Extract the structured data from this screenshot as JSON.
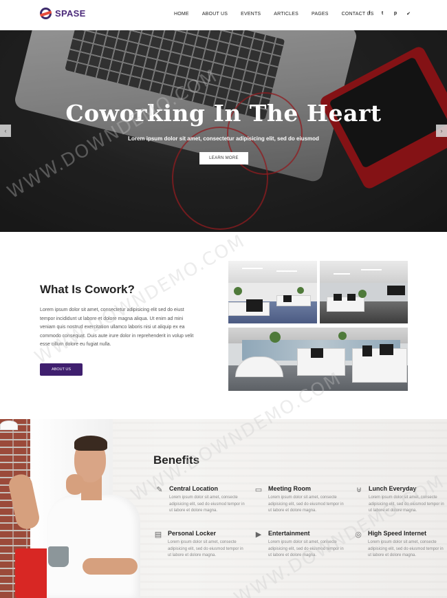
{
  "header": {
    "logo_text": "SPASE",
    "nav": [
      "HOME",
      "ABOUT US",
      "EVENTS",
      "ARTICLES",
      "PAGES",
      "CONTACT US"
    ],
    "social": [
      {
        "glyph": "f",
        "icon": "facebook-icon"
      },
      {
        "glyph": "t",
        "icon": "tumblr-icon"
      },
      {
        "glyph": "p",
        "icon": "pinterest-icon"
      },
      {
        "glyph": "✔",
        "icon": "twitter-icon"
      }
    ]
  },
  "hero": {
    "title": "Coworking In The Heart",
    "subtitle": "Lorem ipsum dolor sit amet, consectetur adipisicing elit, sed do eiusmod",
    "button": "LEARN MORE",
    "prev_arrow": "‹",
    "next_arrow": "›"
  },
  "about": {
    "title": "What Is Cowork?",
    "text": "Lorem ipsum dolor sit amet, consectetur adipisicing elit sed do eiust tempor incididunt ut labore et dolore magna aliqua. Ut enim ad mini veniam quis nostrud exercitation ullamco laboris nisi ut aliquip ex ea commodo consequat. Duis aute irure dolor in reprehenderit in volup velit esse cillum dolore eu fugiat nulla.",
    "button": "ABOUT US"
  },
  "benefits": {
    "title": "Benefits",
    "items": [
      {
        "title": "Central Location",
        "icon": "pencil-icon",
        "glyph": "✎",
        "text": "Lorem ipsum dolor sit amet, consecte adipisicing elit, sed do eiusmod tempor in ut labore et dolore magna."
      },
      {
        "title": "Meeting Room",
        "icon": "presentation-icon",
        "glyph": "▭",
        "text": "Lorem ipsum dolor sit amet, consecte adipisicing elit, sed do eiusmod tempor in ut labore et dolore magna."
      },
      {
        "title": "Lunch Everyday",
        "icon": "basket-icon",
        "glyph": "⊎",
        "text": "Lorem ipsum dolor sit amet, consecte adipisicing elit, sed do eiusmod tempor in ut labore et dolore magna."
      },
      {
        "title": "Personal Locker",
        "icon": "locker-icon",
        "glyph": "▤",
        "text": "Lorem ipsum dolor sit amet, consecte adipisicing elit, sed do eiusmod tempor in ut labore et dolore magna."
      },
      {
        "title": "Entertainment",
        "icon": "film-icon",
        "glyph": "▶",
        "text": "Lorem ipsum dolor sit amet, consecte adipisicing elit, sed do eiusmod tempor in ut labore et dolore magna."
      },
      {
        "title": "High Speed Internet",
        "icon": "wifi-icon",
        "glyph": "◎",
        "text": "Lorem ipsum dolor sit amet, consecte adipisicing elit, sed do eiusmod tempor in ut labore et dolore magna."
      }
    ]
  },
  "watermark": "WWW.DOWNDEMO.COM",
  "colors": {
    "brand_purple": "#3f1f6e",
    "accent_red": "#e74c3c",
    "hero_bg": "#232323"
  }
}
